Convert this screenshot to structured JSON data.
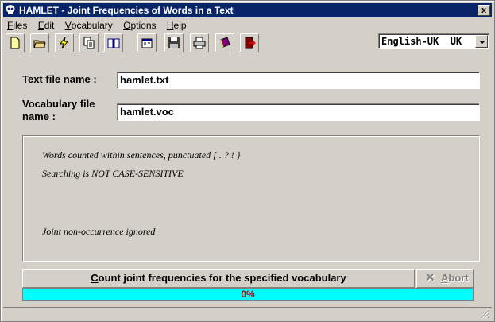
{
  "window": {
    "title": "HAMLET - Joint Frequencies of Words in a Text",
    "close_label": "x"
  },
  "menu": [
    {
      "label": "Files",
      "hotkey": "F",
      "rest": "iles"
    },
    {
      "label": "Edit",
      "hotkey": "E",
      "rest": "dit"
    },
    {
      "label": "Vocabulary",
      "hotkey": "V",
      "rest": "ocabulary"
    },
    {
      "label": "Options",
      "hotkey": "O",
      "rest": "ptions"
    },
    {
      "label": "Help",
      "hotkey": "H",
      "rest": "elp"
    }
  ],
  "toolbar": {
    "icons": [
      "new-file-icon",
      "open-folder-icon",
      "run-lightning-icon",
      "copy-document-icon",
      "open-book-icon",
      "properties-icon",
      "save-disk-icon",
      "print-icon",
      "dictionary-book-icon",
      "exit-door-icon"
    ]
  },
  "language": {
    "value": "English-UK  UK"
  },
  "form": {
    "text_file_label": "Text file name :",
    "text_file_value": "hamlet.txt",
    "vocab_file_label_1": "Vocabulary file",
    "vocab_file_label_2": "name :",
    "vocab_file_value": "hamlet.voc"
  },
  "info": {
    "line1": "Words counted within sentences, punctuated  [ . ? ! }",
    "line2": "Searching is NOT CASE-SENSITIVE",
    "line3": "Joint non-occurrence ignored"
  },
  "actions": {
    "count_hotkey": "C",
    "count_rest": "ount joint frequencies for the specified vocabulary",
    "abort_hotkey": "A",
    "abort_rest": "bort"
  },
  "progress": {
    "text": "0%",
    "value": 0
  },
  "colors": {
    "titlebar": "#0a246a",
    "progress_fill": "#00ffff",
    "progress_text": "#c00000"
  }
}
